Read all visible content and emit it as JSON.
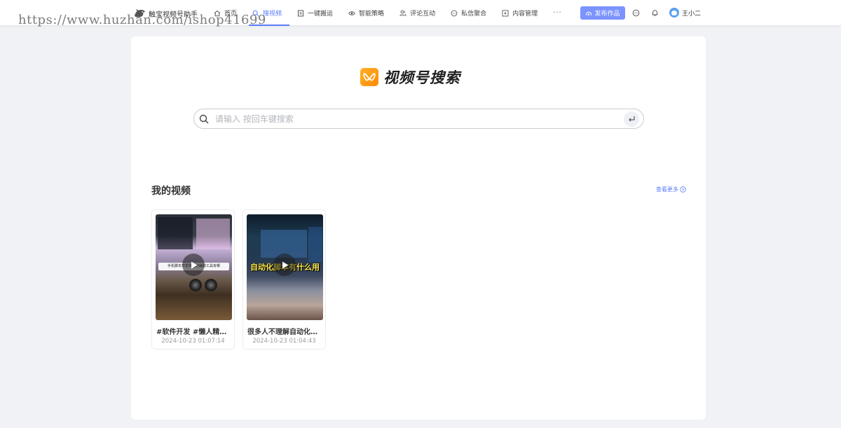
{
  "header": {
    "brand_name": "触宝视频号助手",
    "watermark": "https://www.huzhan.com/ishop41699",
    "nav": [
      {
        "label": "首页",
        "icon": "home-icon",
        "active": false
      },
      {
        "label": "搜视频",
        "icon": "search-icon",
        "active": true
      },
      {
        "label": "一键搬运",
        "icon": "copy-icon",
        "active": false
      },
      {
        "label": "智能策略",
        "icon": "eye-icon",
        "active": false
      },
      {
        "label": "评论互动",
        "icon": "users-icon",
        "active": false
      },
      {
        "label": "私信聚合",
        "icon": "message-icon",
        "active": false
      },
      {
        "label": "内容管理",
        "icon": "play-square-icon",
        "active": false
      }
    ],
    "nav_more": "···",
    "publish_label": "发布作品",
    "user_name": "王小二"
  },
  "hero": {
    "title": "视频号搜索",
    "brand_color": "#ff9900"
  },
  "search": {
    "placeholder": "请输入 按回车键搜索",
    "value": ""
  },
  "my_videos": {
    "title": "我的视频",
    "more_label": "查看更多",
    "items": [
      {
        "title": "#软件开发 #懒人精灵#…",
        "time": "2024-10-23 01:07:14",
        "caption": "手机脚本开发常用的辅助工具有哪"
      },
      {
        "title": "很多人不理解自动化脚…",
        "time": "2024-10-23 01:04:43",
        "caption": "自动化脚本有什么用"
      }
    ]
  },
  "colors": {
    "accent": "#5b7cfa",
    "publish_button": "#7b93ff",
    "page_background": "#f0f2f5"
  }
}
